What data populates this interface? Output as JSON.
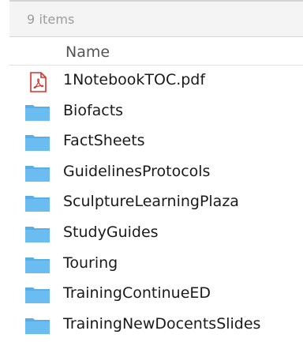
{
  "status": {
    "item_count": "9 items"
  },
  "columns": {
    "name": "Name"
  },
  "files": [
    {
      "name": "1NotebookTOC.pdf",
      "kind": "pdf-icon"
    },
    {
      "name": "Biofacts",
      "kind": "folder-icon"
    },
    {
      "name": "FactSheets",
      "kind": "folder-icon"
    },
    {
      "name": "GuidelinesProtocols",
      "kind": "folder-icon"
    },
    {
      "name": "SculptureLearningPlaza",
      "kind": "folder-icon"
    },
    {
      "name": "StudyGuides",
      "kind": "folder-icon"
    },
    {
      "name": "Touring",
      "kind": "folder-icon"
    },
    {
      "name": "TrainingContinueED",
      "kind": "folder-icon"
    },
    {
      "name": "TrainingNewDocentsSlides",
      "kind": "folder-icon"
    }
  ],
  "colors": {
    "folder": "#5aaee6",
    "pdf_accent": "#d9322c"
  }
}
